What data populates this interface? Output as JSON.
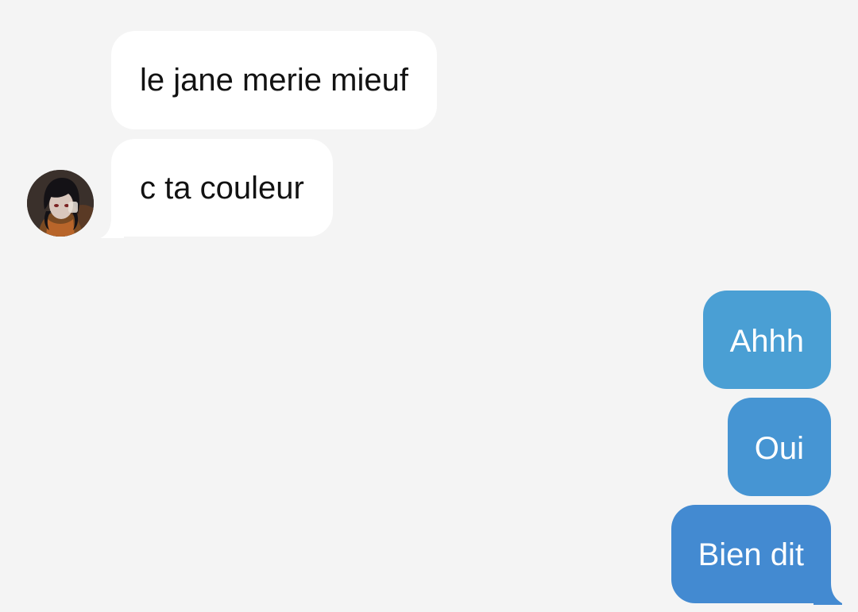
{
  "conversation": {
    "messages": [
      {
        "direction": "incoming",
        "text": "le jane merie mieuf"
      },
      {
        "direction": "incoming",
        "text": "c ta couleur"
      },
      {
        "direction": "outgoing",
        "text": "Ahhh"
      },
      {
        "direction": "outgoing",
        "text": "Oui"
      },
      {
        "direction": "outgoing",
        "text": "Bien dit"
      }
    ]
  },
  "contact": {
    "avatar_icon": "profile-photo-anime-character"
  },
  "colors": {
    "background": "#f4f4f4",
    "incoming_bubble": "#ffffff",
    "incoming_text": "#121212",
    "outgoing_bubble_top": "#4a9fd4",
    "outgoing_bubble_bottom": "#438ad1",
    "outgoing_text": "#ffffff"
  }
}
